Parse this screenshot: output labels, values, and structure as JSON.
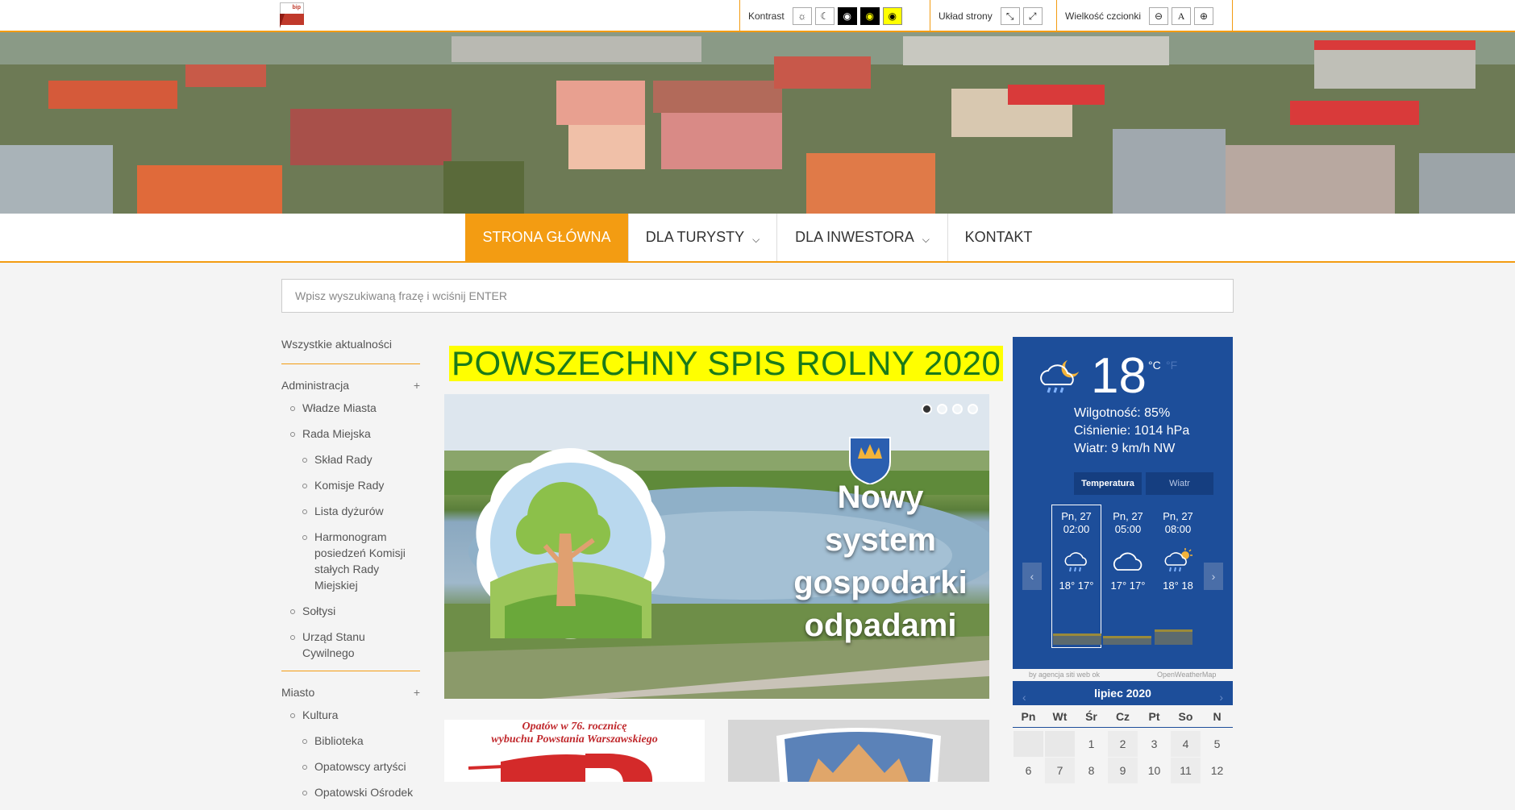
{
  "toolbar": {
    "logo_text": "bip",
    "contrast_label": "Kontrast",
    "layout_label": "Układ strony",
    "font_size_label": "Wielkość czcionki",
    "font_default_glyph": "A"
  },
  "nav": {
    "items": [
      {
        "label": "STRONA GŁÓWNA",
        "active": true
      },
      {
        "label": "DLA TURYSTY",
        "dropdown": true
      },
      {
        "label": "DLA INWESTORA",
        "dropdown": true
      },
      {
        "label": "KONTAKT"
      }
    ]
  },
  "search": {
    "placeholder": "Wpisz wyszukiwaną frazę i wciśnij ENTER"
  },
  "sidebar": {
    "all_news": "Wszystkie aktualności",
    "sections": [
      {
        "label": "Administracja",
        "toggle": "+",
        "items": [
          {
            "label": "Władze Miasta",
            "level": 1
          },
          {
            "label": "Rada Miejska",
            "level": 1
          },
          {
            "label": "Skład Rady",
            "level": 2
          },
          {
            "label": "Komisje Rady",
            "level": 2
          },
          {
            "label": "Lista dyżurów",
            "level": 2
          },
          {
            "label": "Harmonogram posiedzeń Komisji stałych Rady Miejskiej",
            "level": 2
          },
          {
            "label": "Sołtysi",
            "level": 1
          },
          {
            "label": "Urząd Stanu Cywilnego",
            "level": 1
          }
        ]
      },
      {
        "label": "Miasto",
        "toggle": "+",
        "items": [
          {
            "label": "Kultura",
            "level": 1
          },
          {
            "label": "Biblioteka",
            "level": 2
          },
          {
            "label": "Opatowscy artyści",
            "level": 2
          },
          {
            "label": "Opatowski Ośrodek",
            "level": 2
          }
        ]
      }
    ]
  },
  "main": {
    "headline": "POWSZECHNY SPIS ROLNY 2020",
    "slider": {
      "caption_lines": [
        "Nowy",
        "system",
        "gospodarki",
        "odpadami"
      ],
      "slide_count": 4,
      "active_slide": 1
    },
    "thumb1_text_line1": "Opatów w 76. rocznicę",
    "thumb1_text_line2": "wybuchu Powstania Warszawskiego"
  },
  "weather": {
    "temperature": "18",
    "unit_c": "°C",
    "unit_f": "°F",
    "humidity": "Wilgotność: 85%",
    "pressure": "Ciśnienie: 1014 hPa",
    "wind": "Wiatr: 9 km/h NW",
    "tabs": [
      "Temperatura",
      "Wiatr"
    ],
    "forecast": [
      {
        "day": "Pn, 27",
        "time": "02:00",
        "temps": "18° 17°",
        "icon": "night-rain-icon"
      },
      {
        "day": "Pn, 27",
        "time": "05:00",
        "temps": "17° 17°",
        "icon": "cloud-icon"
      },
      {
        "day": "Pn, 27",
        "time": "08:00",
        "temps": "18° 18",
        "icon": "sun-rain-icon"
      }
    ],
    "prev_arrow": "‹",
    "next_arrow": "›",
    "credit_left": "by agencja siti web ok",
    "credit_right": "OpenWeatherMap"
  },
  "calendar": {
    "month": "lipiec 2020",
    "prev": "‹",
    "next": "›",
    "weekdays": [
      "Pn",
      "Wt",
      "Śr",
      "Cz",
      "Pt",
      "So",
      "N"
    ],
    "rows": [
      [
        "",
        "",
        "1",
        "2",
        "3",
        "4",
        "5"
      ],
      [
        "6",
        "7",
        "8",
        "9",
        "10",
        "11",
        "12"
      ]
    ]
  }
}
